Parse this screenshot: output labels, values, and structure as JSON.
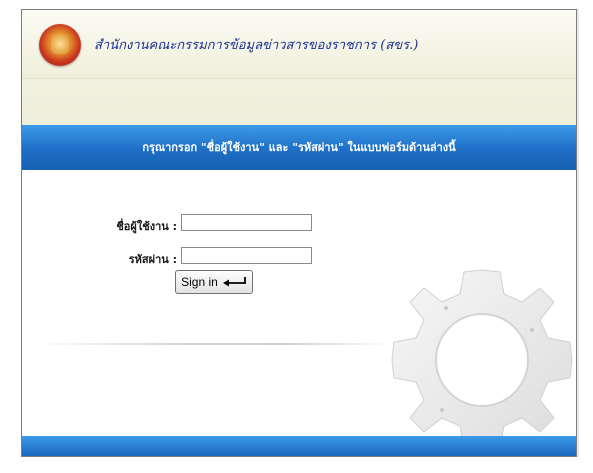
{
  "header": {
    "org_name": "สำนักงานคณะกรรมการข้อมูลข่าวสารของราชการ (สขร.)",
    "logo_icon": "emblem-icon"
  },
  "login": {
    "instruction": "กรุณากรอก \"ชื่อผู้ใช้งาน\" และ \"รหัสผ่าน\" ในแบบฟอร์มด้านล่างนี้",
    "username_label": "ชื่อผู้ใช้งาน :",
    "username_value": "",
    "password_label": "รหัสผ่าน :",
    "password_value": "",
    "signin_label": "Sign in",
    "signin_icon": "enter-arrow-icon"
  },
  "colors": {
    "header_bg": "#f0efdc",
    "bar_blue": "#1e6fc6",
    "title_blue": "#1a2f8f"
  }
}
